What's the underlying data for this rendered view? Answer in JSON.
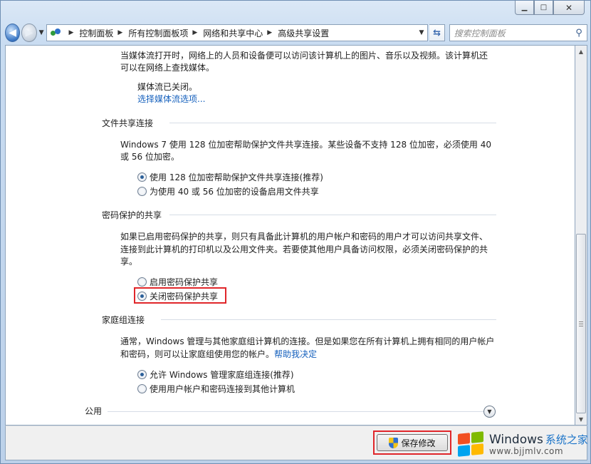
{
  "window": {
    "minimize_glyph": "▁",
    "maximize_glyph": "□",
    "close_glyph": "✕"
  },
  "nav": {
    "back_icon": "back-arrow-icon",
    "forward_icon": "forward-arrow-icon",
    "breadcrumbs": [
      "控制面板",
      "所有控制面板项",
      "网络和共享中心",
      "高级共享设置"
    ],
    "search_placeholder": "搜索控制面板"
  },
  "media": {
    "description_line1": "当媒体流打开时，网络上的人员和设备便可以访问该计算机上的图片、音乐以及视频。该计算机还",
    "description_line2": "可以在网络上查找媒体。",
    "status": "媒体流已关闭。",
    "link": "选择媒体流选项..."
  },
  "file_sharing": {
    "title": "文件共享连接",
    "description_line1": "Windows 7 使用 128 位加密帮助保护文件共享连接。某些设备不支持 128 位加密，必须使用 40",
    "description_line2": "或 56 位加密。",
    "options": [
      {
        "label": "使用 128 位加密帮助保护文件共享连接(推荐)",
        "checked": true
      },
      {
        "label": "为使用 40 或 56 位加密的设备启用文件共享",
        "checked": false
      }
    ]
  },
  "password_sharing": {
    "title": "密码保护的共享",
    "description_line1": "如果已启用密码保护的共享，则只有具备此计算机的用户帐户和密码的用户才可以访问共享文件、",
    "description_line2": "连接到此计算机的打印机以及公用文件夹。若要使其他用户具备访问权限，必须关闭密码保护的共",
    "description_line3": "享。",
    "options": [
      {
        "label": "启用密码保护共享",
        "checked": false
      },
      {
        "label": "关闭密码保护共享",
        "checked": true
      }
    ]
  },
  "homegroup": {
    "title": "家庭组连接",
    "description_line1": "通常，Windows 管理与其他家庭组计算机的连接。但是如果您在所有计算机上拥有相同的用户帐户",
    "description_line2_prefix": "和密码，则可以让家庭组使用您的帐户。",
    "help_link": "帮助我决定",
    "options": [
      {
        "label": "允许 Windows 管理家庭组连接(推荐)",
        "checked": true
      },
      {
        "label": "使用用户帐户和密码连接到其他计算机",
        "checked": false
      }
    ]
  },
  "public_section": {
    "title": "公用"
  },
  "footer": {
    "save_label": "保存修改"
  },
  "watermark": {
    "brand": "Windows",
    "brand_cn": "系统之家",
    "url": "www.bjjmlv.com"
  },
  "colors": {
    "highlight": "#e0262a",
    "link": "#1560bd"
  }
}
